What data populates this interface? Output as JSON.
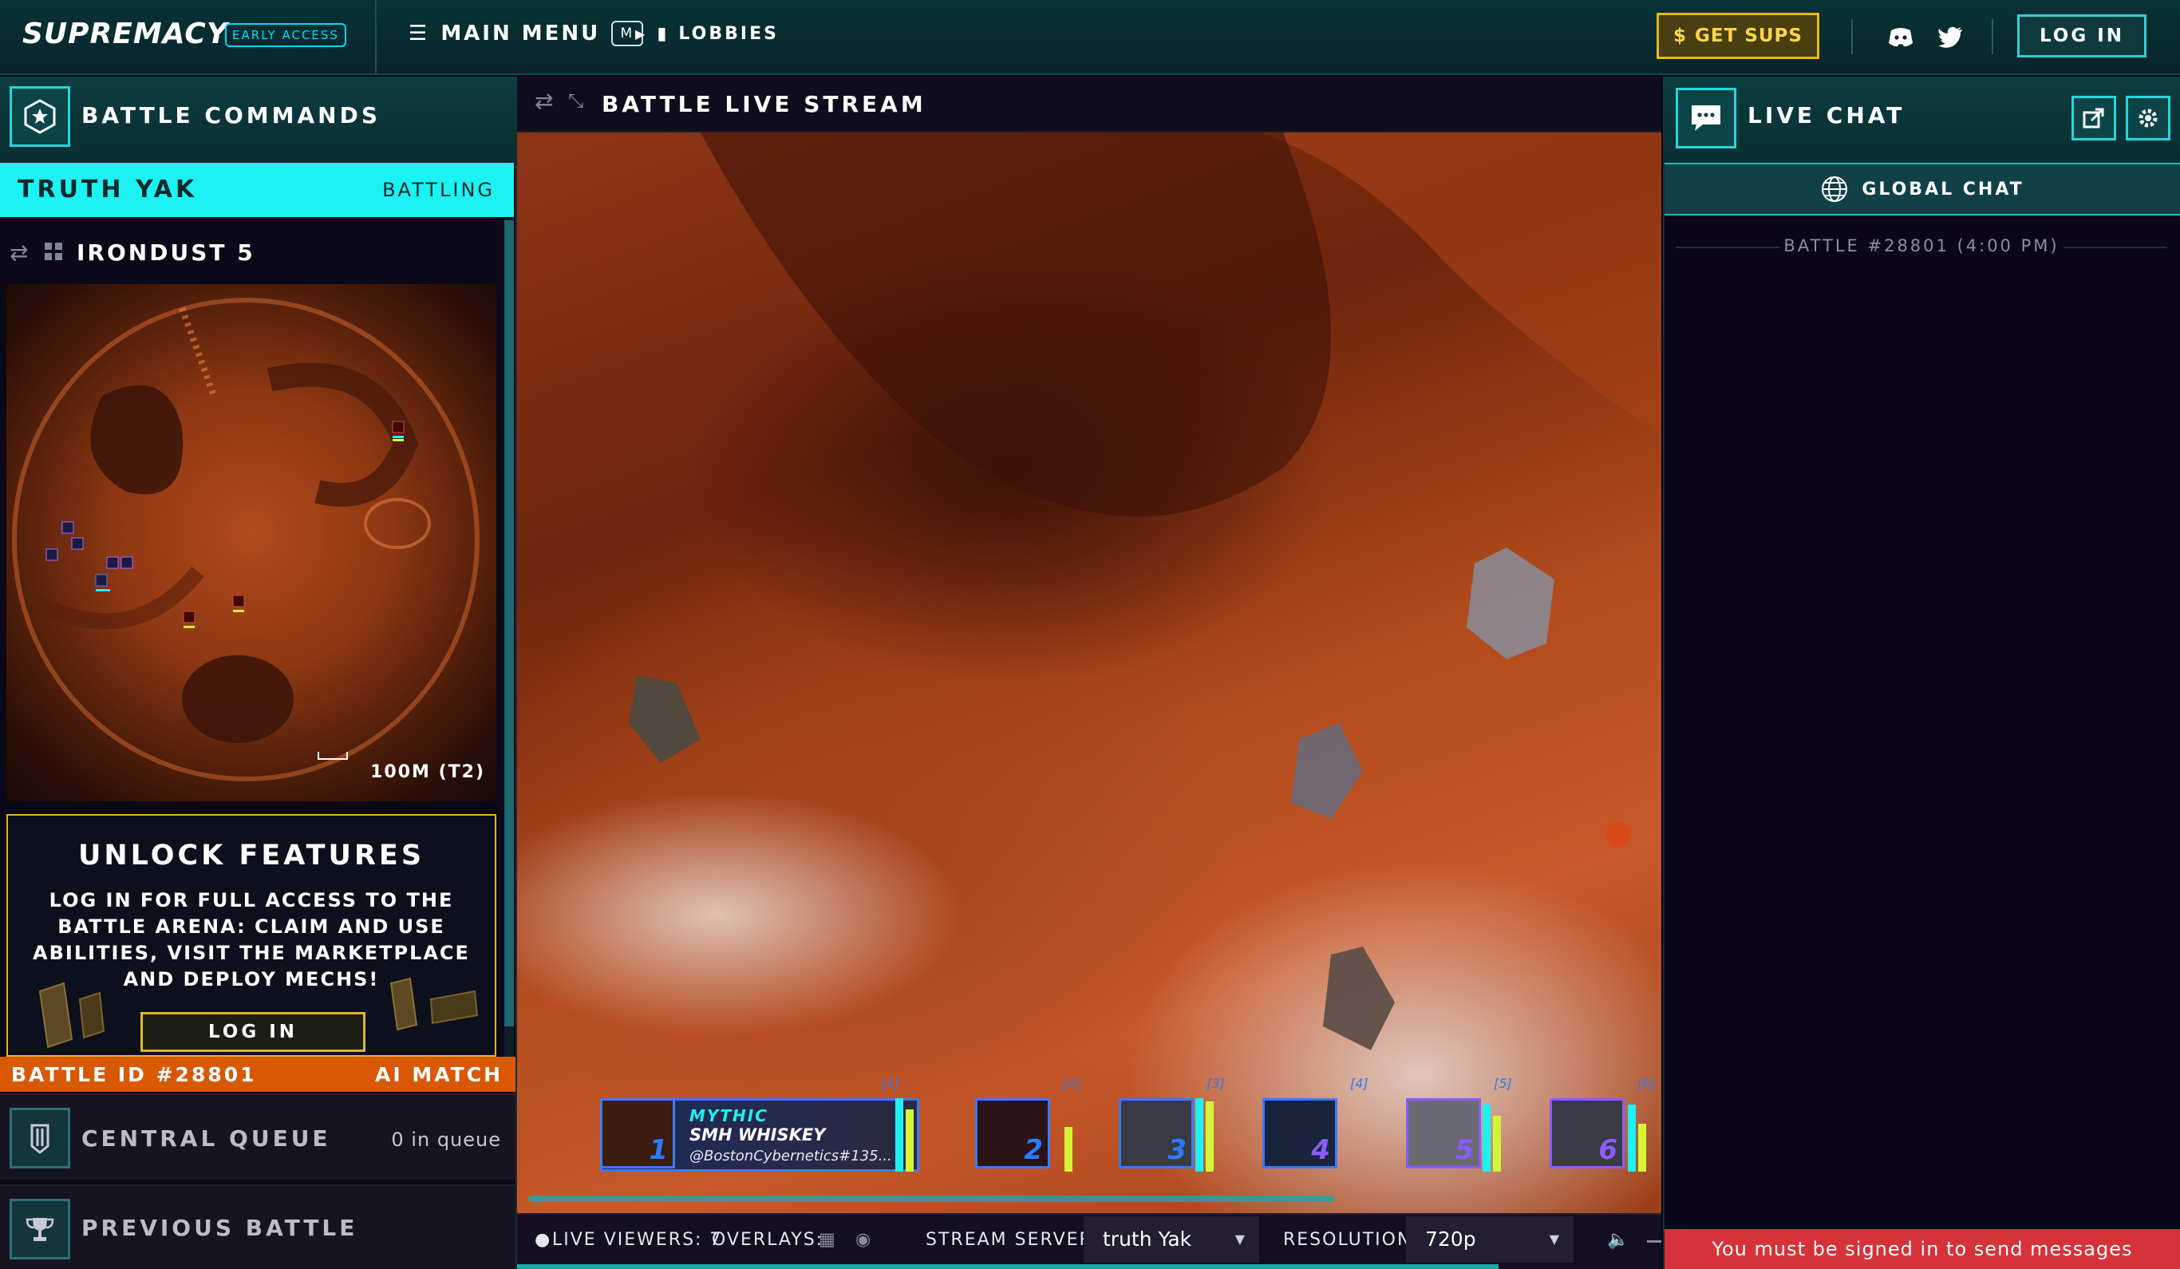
{
  "topbar": {
    "logo": "SUPREMACY",
    "badge": "EARLY ACCESS",
    "main_menu": "MAIN MENU",
    "main_menu_key": "M",
    "breadcrumb": "LOBBIES",
    "get_sups": "GET SUPS",
    "login": "LOG IN"
  },
  "left": {
    "title": "BATTLE COMMANDS",
    "player_name": "TRUTH YAK",
    "player_status": "BATTLING",
    "map_name": "IRONDUST 5",
    "map_scale": "100M (T2)",
    "unlock_title": "UNLOCK FEATURES",
    "unlock_text": "LOG IN FOR FULL ACCESS TO THE BATTLE ARENA: CLAIM AND USE ABILITIES, VISIT THE MARKETPLACE AND DEPLOY MECHS!",
    "unlock_button": "LOG IN",
    "battle_id": "BATTLE ID #28801",
    "match_type": "AI MATCH",
    "queue_label": "CENTRAL QUEUE",
    "queue_count": "0 in queue",
    "previous_battle": "PREVIOUS BATTLE"
  },
  "stream": {
    "title": "BATTLE LIVE STREAM",
    "mechs": [
      {
        "idx": "[1]",
        "num": "1",
        "rarity": "MYTHIC",
        "name": "SMH WHISKEY",
        "owner": "@BostonCybernetics#135...",
        "bars": [
          1.0,
          0.8,
          0.6
        ]
      },
      {
        "idx": "[2]",
        "num": "2",
        "bars": [
          0.0,
          0.0,
          0.6
        ]
      },
      {
        "idx": "[3]",
        "num": "3",
        "bars": [
          1.0,
          1.0,
          0.9
        ]
      },
      {
        "idx": "[4]",
        "num": "4",
        "bars": [
          0.0,
          0.0,
          0.0
        ]
      },
      {
        "idx": "[5]",
        "num": "5",
        "bars": [
          0.9,
          0.9,
          0.7
        ]
      },
      {
        "idx": "[6]",
        "num": "6",
        "bars": [
          0.9,
          0.9,
          0.6
        ]
      }
    ]
  },
  "toolbar": {
    "viewers": "LIVE VIEWERS: 7",
    "overlays": "OVERLAYS:",
    "server_label": "STREAM SERVER:",
    "server_value": "truth Yak",
    "resolution_label": "RESOLUTION:",
    "resolution_value": "720p"
  },
  "chat": {
    "title": "LIVE CHAT",
    "tab": "GLOBAL CHAT",
    "separator": "BATTLE #28801 (4:00 PM)",
    "signin_notice": "You must be signed in to send messages"
  },
  "colors": {
    "accent_cyan": "#1cf2f2",
    "gold": "#e0b81e",
    "orange": "#d85804",
    "alert_red": "#d6323a"
  }
}
